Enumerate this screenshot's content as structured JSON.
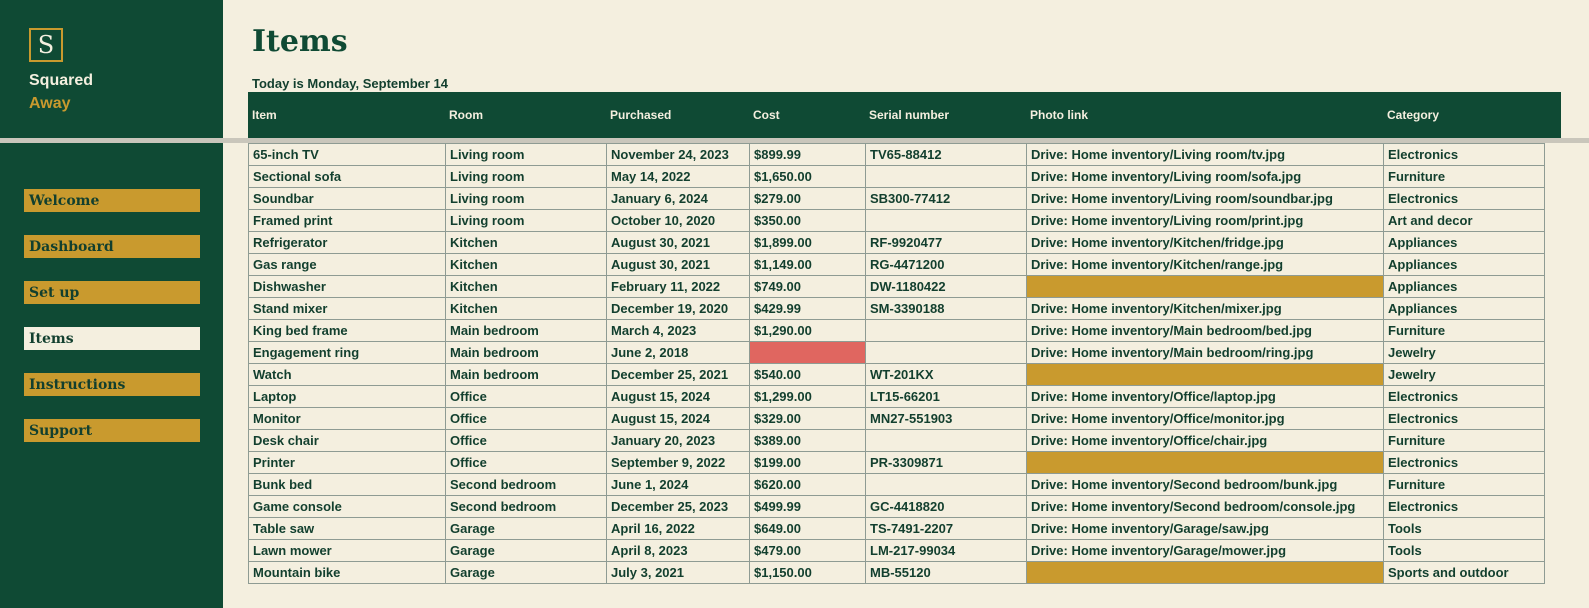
{
  "brand": {
    "logo_letter": "S",
    "line1": "Squared",
    "line2": "Away"
  },
  "nav": [
    "Welcome",
    "Dashboard",
    "Set up",
    "Items",
    "Instructions",
    "Support"
  ],
  "active_nav": "Items",
  "page": {
    "title": "Items",
    "today": "Today is Monday, September 14"
  },
  "columns": [
    "Item",
    "Room",
    "Purchased",
    "Cost",
    "Serial number",
    "Photo link",
    "Category"
  ],
  "rows": [
    [
      "65-inch TV",
      "Living room",
      "November 24, 2023",
      "$899.99",
      "TV65-88412",
      "Drive: Home inventory/Living room/tv.jpg",
      "Electronics"
    ],
    [
      "Sectional sofa",
      "Living room",
      "May 14, 2022",
      "$1,650.00",
      "",
      "Drive: Home inventory/Living room/sofa.jpg",
      "Furniture"
    ],
    [
      "Soundbar",
      "Living room",
      "January 6, 2024",
      "$279.00",
      "SB300-77412",
      "Drive: Home inventory/Living room/soundbar.jpg",
      "Electronics"
    ],
    [
      "Framed print",
      "Living room",
      "October 10, 2020",
      "$350.00",
      "",
      "Drive: Home inventory/Living room/print.jpg",
      "Art and decor"
    ],
    [
      "Refrigerator",
      "Kitchen",
      "August 30, 2021",
      "$1,899.00",
      "RF-9920477",
      "Drive: Home inventory/Kitchen/fridge.jpg",
      "Appliances"
    ],
    [
      "Gas range",
      "Kitchen",
      "August 30, 2021",
      "$1,149.00",
      "RG-4471200",
      "Drive: Home inventory/Kitchen/range.jpg",
      "Appliances"
    ],
    [
      "Dishwasher",
      "Kitchen",
      "February 11, 2022",
      "$749.00",
      "DW-1180422",
      "",
      "Appliances"
    ],
    [
      "Stand mixer",
      "Kitchen",
      "December 19, 2020",
      "$429.99",
      "SM-3390188",
      "Drive: Home inventory/Kitchen/mixer.jpg",
      "Appliances"
    ],
    [
      "King bed frame",
      "Main bedroom",
      "March 4, 2023",
      "$1,290.00",
      "",
      "Drive: Home inventory/Main bedroom/bed.jpg",
      "Furniture"
    ],
    [
      "Engagement ring",
      "Main bedroom",
      "June 2, 2018",
      "",
      "",
      "Drive: Home inventory/Main bedroom/ring.jpg",
      "Jewelry"
    ],
    [
      "Watch",
      "Main bedroom",
      "December 25, 2021",
      "$540.00",
      "WT-201KX",
      "",
      "Jewelry"
    ],
    [
      "Laptop",
      "Office",
      "August 15, 2024",
      "$1,299.00",
      "LT15-66201",
      "Drive: Home inventory/Office/laptop.jpg",
      "Electronics"
    ],
    [
      "Monitor",
      "Office",
      "August 15, 2024",
      "$329.00",
      "MN27-551903",
      "Drive: Home inventory/Office/monitor.jpg",
      "Electronics"
    ],
    [
      "Desk chair",
      "Office",
      "January 20, 2023",
      "$389.00",
      "",
      "Drive: Home inventory/Office/chair.jpg",
      "Furniture"
    ],
    [
      "Printer",
      "Office",
      "September 9, 2022",
      "$199.00",
      "PR-3309871",
      "",
      "Electronics"
    ],
    [
      "Bunk bed",
      "Second bedroom",
      "June 1, 2024",
      "$620.00",
      "",
      "Drive: Home inventory/Second bedroom/bunk.jpg",
      "Furniture"
    ],
    [
      "Game console",
      "Second bedroom",
      "December 25, 2023",
      "$499.99",
      "GC-4418820",
      "Drive: Home inventory/Second bedroom/console.jpg",
      "Electronics"
    ],
    [
      "Table saw",
      "Garage",
      "April 16, 2022",
      "$649.00",
      "TS-7491-2207",
      "Drive: Home inventory/Garage/saw.jpg",
      "Tools"
    ],
    [
      "Lawn mower",
      "Garage",
      "April 8, 2023",
      "$479.00",
      "LM-217-99034",
      "Drive: Home inventory/Garage/mower.jpg",
      "Tools"
    ],
    [
      "Mountain bike",
      "Garage",
      "July 3, 2021",
      "$1,150.00",
      "MB-55120",
      "",
      "Sports and outdoor"
    ]
  ],
  "colors": {
    "sidebar": "#0f4a34",
    "gold": "#c99a2e",
    "cream": "#f4efdf",
    "missing_cost": "#e06660"
  }
}
